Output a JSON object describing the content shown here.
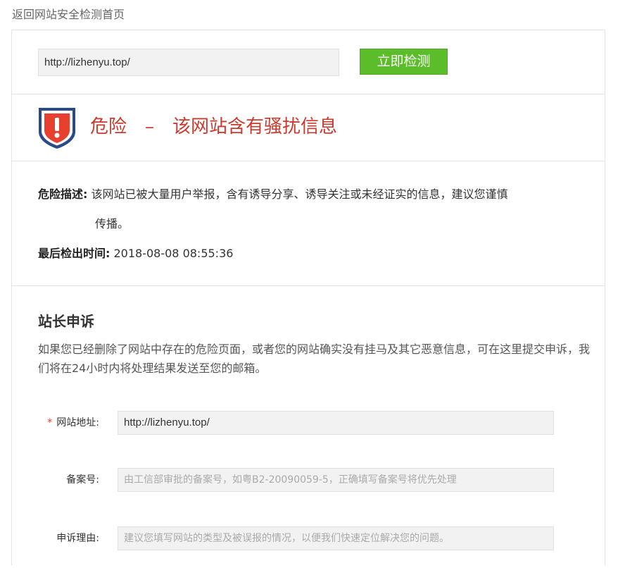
{
  "nav": {
    "back_link": "返回网站安全检测首页"
  },
  "search": {
    "url": "http://lizhenyu.top/",
    "button": "立即检测"
  },
  "verdict": {
    "level": "危险",
    "separator": "–",
    "message": "该网站含有骚扰信息",
    "icon": "danger-shield-icon",
    "color": "#cc3a2e"
  },
  "detail": {
    "desc_label": "危险描述:",
    "desc_text": "该网站已被大量用户举报，含有诱导分享、诱导关注或未经证实的信息，建议您谨慎",
    "desc_text_cont": "传播。",
    "time_label": "最后检出时间:",
    "time_value": "2018-08-08 08:55:36"
  },
  "appeal": {
    "title": "站长申诉",
    "description": "如果您已经删除了网站中存在的危险页面，或者您的网站确实没有挂马及其它恶意信息，可在这里提交申诉，我们将在24小时内将处理结果发送至您的邮箱。",
    "fields": {
      "url": {
        "required_mark": "*",
        "label": "网站地址:",
        "value": "http://lizhenyu.top/"
      },
      "icp": {
        "label": "备案号:",
        "placeholder": "由工信部审批的备案号，如粤B2-20090059-5，正确填写备案号将优先处理"
      },
      "reason": {
        "label": "申诉理由:",
        "placeholder": "建议您填写网站的类型及被误报的情况，以便我们快速定位解决您的问题。"
      }
    }
  },
  "colors": {
    "accent_green": "#5cbd2a",
    "danger_red": "#cc3a2e",
    "shield_blue": "#2b4a8c"
  }
}
